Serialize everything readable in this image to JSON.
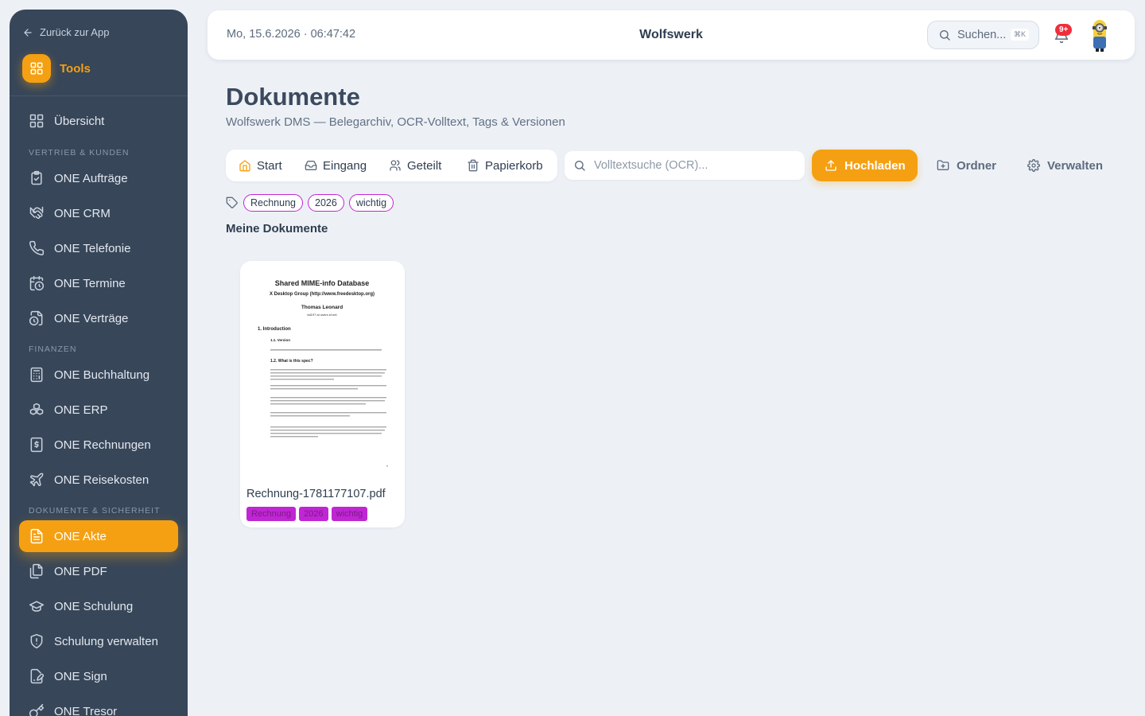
{
  "colors": {
    "accent": "#f5a012",
    "sidebar": "#374659",
    "tag": "#c026d3",
    "badge": "#ef2f3c"
  },
  "sidebar": {
    "back_label": "Zurück zur App",
    "tools_label": "Tools",
    "overview_label": "Übersicht",
    "sections": {
      "vertrieb": "VERTRIEB & KUNDEN",
      "finanzen": "FINANZEN",
      "dokumente": "DOKUMENTE & SICHERHEIT"
    },
    "items": [
      {
        "label": "ONE Aufträge",
        "icon": "clipboard-check-icon"
      },
      {
        "label": "ONE CRM",
        "icon": "handshake-icon"
      },
      {
        "label": "ONE Telefonie",
        "icon": "phone-icon"
      },
      {
        "label": "ONE Termine",
        "icon": "calendar-clock-icon"
      },
      {
        "label": "ONE Verträge",
        "icon": "file-clock-icon"
      },
      {
        "label": "ONE Buchhaltung",
        "icon": "calculator-icon"
      },
      {
        "label": "ONE ERP",
        "icon": "boxes-icon"
      },
      {
        "label": "ONE Rechnungen",
        "icon": "receipt-dollar-icon"
      },
      {
        "label": "ONE Reisekosten",
        "icon": "plane-icon"
      },
      {
        "label": "ONE Akte",
        "icon": "file-text-icon",
        "active": true
      },
      {
        "label": "ONE PDF",
        "icon": "files-icon"
      },
      {
        "label": "ONE Schulung",
        "icon": "graduation-cap-icon"
      },
      {
        "label": "Schulung verwalten",
        "icon": "shield-icon"
      },
      {
        "label": "ONE Sign",
        "icon": "file-signature-icon"
      },
      {
        "label": "ONE Tresor",
        "icon": "key-icon"
      }
    ]
  },
  "header": {
    "datetime": "Mo, 15.6.2026 · 06:47:42",
    "brand": "Wolfswerk",
    "search_placeholder": "Suchen...",
    "search_shortcut": "⌘K",
    "notifications_badge": "9+"
  },
  "main": {
    "title": "Dokumente",
    "subtitle": "Wolfswerk DMS — Belegarchiv, OCR-Volltext, Tags & Versionen",
    "tabs": [
      {
        "label": "Start",
        "icon": "home-icon"
      },
      {
        "label": "Eingang",
        "icon": "inbox-icon"
      },
      {
        "label": "Geteilt",
        "icon": "users-icon"
      },
      {
        "label": "Papierkorb",
        "icon": "trash-icon"
      }
    ],
    "ocr_placeholder": "Volltextsuche (OCR)...",
    "upload_label": "Hochladen",
    "folder_label": "Ordner",
    "manage_label": "Verwalten",
    "filter_tags": [
      "Rechnung",
      "2026",
      "wichtig"
    ],
    "section_title": "Meine Dokumente",
    "documents": [
      {
        "filename": "Rechnung-1781177107.pdf",
        "tags": [
          "Rechnung",
          "2026",
          "wichtig"
        ],
        "preview": {
          "title": "Shared MIME-info Database",
          "subtitle": "X Desktop Group (http://www.freedesktop.org)",
          "author": "Thomas Leonard",
          "email": "tal197 at users.sf.net",
          "h1": "1. Introduction",
          "h2a": "1.1. Version",
          "h2b": "1.2. What is this spec?"
        }
      }
    ]
  }
}
